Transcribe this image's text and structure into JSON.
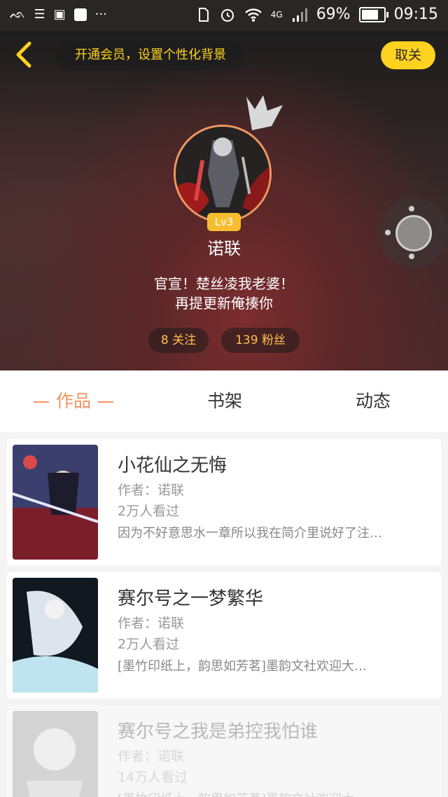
{
  "status_bar": {
    "network": "4G",
    "battery": "69%",
    "battery_level": 0.69,
    "time": "09:15",
    "more": "···"
  },
  "header": {
    "vip_prompt": "开通会员，设置个性化背景",
    "cancel_label": "取关"
  },
  "profile": {
    "level": "Lv3",
    "nickname": "诺联",
    "bio_line1": "官宣！楚丝凌我老婆！",
    "bio_line2": "再提更新俺揍你",
    "following": "8 关注",
    "fans": "139 粉丝"
  },
  "tabs": [
    "作品",
    "书架",
    "动态"
  ],
  "active_tab": "作品",
  "books": [
    {
      "title": "小花仙之无悔",
      "author": "作者：诺联",
      "views": "2万人看过",
      "desc": "因为不好意思水一章所以我在简介里说好了注…"
    },
    {
      "title": "赛尔号之一梦繁华",
      "author": "作者：诺联",
      "views": "2万人看过",
      "desc": "[墨竹印纸上，韵思如芳茗]墨韵文社欢迎大…"
    },
    {
      "title": "赛尔号之我是弟控我怕谁",
      "author": "作者：诺联",
      "views": "14万人看过",
      "desc": "[墨竹印纸上，韵思如芳茗]墨韵文社欢迎大…"
    }
  ],
  "colors": {
    "accent": "#f3935e",
    "vip_yellow": "#ffd21f",
    "level_badge": "#f7bd2f"
  }
}
